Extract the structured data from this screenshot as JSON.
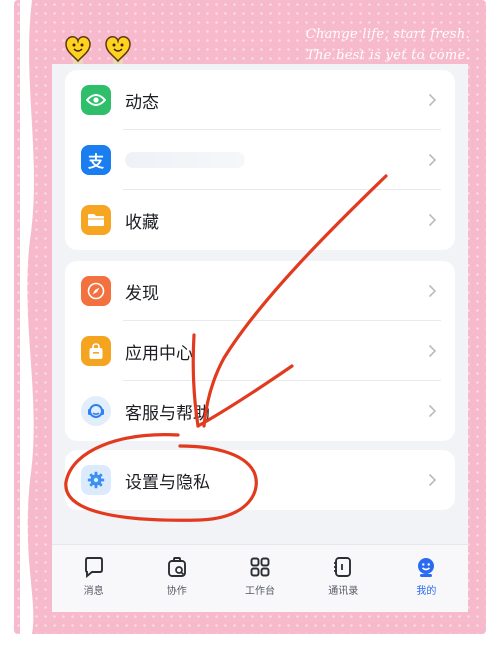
{
  "poster": {
    "tagline_line1": "Change life, start fresh.",
    "tagline_line2": "The best is yet to come."
  },
  "menu_group_1": [
    {
      "label": "动态",
      "icon": "eye-icon",
      "color": "#2fbf6a"
    },
    {
      "label": "",
      "icon": "alipay-icon",
      "color": "#1a7df0"
    },
    {
      "label": "收藏",
      "icon": "folder-icon",
      "color": "#f6a623"
    }
  ],
  "menu_group_2": [
    {
      "label": "发现",
      "icon": "compass-icon",
      "color": "#f2713f"
    },
    {
      "label": "应用中心",
      "icon": "bag-icon",
      "color": "#f5a41f"
    },
    {
      "label": "客服与帮助",
      "icon": "headset-icon",
      "color": "#2e82f0"
    }
  ],
  "menu_group_3": [
    {
      "label": "设置与隐私",
      "icon": "gear-icon",
      "color": "#3a8ff2"
    }
  ],
  "tabbar": {
    "items": [
      {
        "label": "消息",
        "icon": "chat-icon"
      },
      {
        "label": "协作",
        "icon": "collab-icon"
      },
      {
        "label": "工作台",
        "icon": "grid-icon"
      },
      {
        "label": "通讯录",
        "icon": "contacts-icon"
      },
      {
        "label": "我的",
        "icon": "person-icon",
        "active": true
      }
    ],
    "active_color": "#2a6bf2"
  },
  "annotation_color": "#e23a1e"
}
